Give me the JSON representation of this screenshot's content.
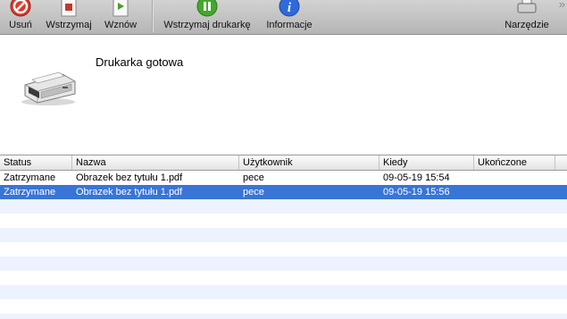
{
  "toolbar": {
    "buttons": [
      {
        "label": "Usuń",
        "icon": "delete-icon"
      },
      {
        "label": "Wstrzymaj",
        "icon": "hold-job-icon"
      },
      {
        "label": "Wznów",
        "icon": "resume-job-icon"
      },
      {
        "label": "Wstrzymaj drukarkę",
        "icon": "pause-printer-icon"
      },
      {
        "label": "Informacje",
        "icon": "info-icon"
      },
      {
        "label": "Narzędzie",
        "icon": "printer-utility-icon"
      }
    ],
    "overflow_glyph": "»"
  },
  "printer": {
    "status": "Drukarka gotowa",
    "icon": "printer-icon"
  },
  "table": {
    "columns": [
      "Status",
      "Nazwa",
      "Użytkownik",
      "Kiedy",
      "Ukończone"
    ],
    "rows": [
      {
        "status": "Zatrzymane",
        "name": "Obrazek bez tytułu 1.pdf",
        "user": "pece",
        "when": "09-05-19 15:54",
        "completed": ""
      },
      {
        "status": "Zatrzymane",
        "name": "Obrazek bez tytułu 1.pdf",
        "user": "pece",
        "when": "09-05-19 15:56",
        "completed": "",
        "selected": true
      }
    ]
  },
  "colors": {
    "selection": "#3875d7",
    "stripe": "#edf3fe",
    "delete_red": "#d93a2b",
    "pause_green": "#43a82e",
    "info_blue": "#2f6ad8"
  }
}
